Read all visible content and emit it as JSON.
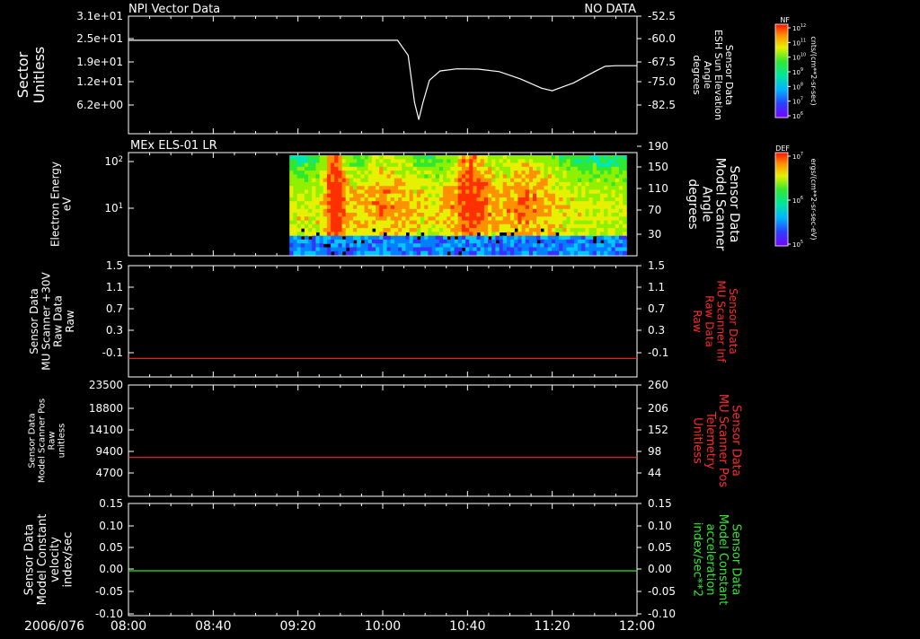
{
  "header": {
    "left_title": "NPI Vector Data",
    "right_status": "NO DATA"
  },
  "time_axis": {
    "date_label": "2006/076",
    "ticks": [
      "08:00",
      "08:40",
      "09:20",
      "10:00",
      "10:40",
      "11:20",
      "12:00"
    ]
  },
  "colors": {
    "background": "#000000",
    "axis": "#ffffff",
    "red_trace": "#ff2a2a",
    "green_trace": "#2ee82e",
    "red_label": "#ff2a2a",
    "green_label": "#2ee82e"
  },
  "colorbars": [
    {
      "title": "NF",
      "ticks": [
        "10^12",
        "10^11",
        "10^10",
        "10^9",
        "10^8",
        "10^7",
        "10^6"
      ],
      "units": "cnts/(cm**2-sr-sec)"
    },
    {
      "title": "DEF",
      "ticks": [
        "10^7",
        "10^6",
        "10^5"
      ],
      "units": "ergs/(cm**2-sr-sec-eV)"
    }
  ],
  "chart_data": [
    {
      "type": "line",
      "panel": 1,
      "left_axis": {
        "label_lines": [
          "Sector",
          "Unitless"
        ],
        "ticks": [
          "3.1e+01",
          "2.5e+01",
          "1.9e+01",
          "1.2e+01",
          "6.2e+00"
        ]
      },
      "right_axis": {
        "label_lines": [
          "Sensor Data",
          "ESH Sun Elevation",
          "Angle",
          "degrees"
        ],
        "ticks": [
          "-52.5",
          "-60.0",
          "-67.5",
          "-75.0",
          "-82.5"
        ],
        "range": [
          -90,
          -52.5
        ]
      },
      "series": [
        {
          "color": "#ffffff",
          "x": [
            "08:00",
            "09:00",
            "10:00",
            "10:07",
            "10:12",
            "10:15",
            "10:17",
            "10:19",
            "10:22",
            "10:27",
            "10:35",
            "10:45",
            "10:55",
            "11:05",
            "11:15",
            "11:20",
            "11:30",
            "11:40",
            "11:45",
            "11:50",
            "12:00"
          ],
          "y": [
            -60.2,
            -60.2,
            -60.2,
            -60.2,
            -65,
            -80,
            -85.5,
            -80,
            -73,
            -70,
            -69.3,
            -69.4,
            -70.2,
            -72.5,
            -75.5,
            -76.3,
            -73.8,
            -70.2,
            -68.5,
            -68.3,
            -68.3
          ]
        }
      ]
    },
    {
      "type": "heatmap",
      "panel": 2,
      "title": "MEx ELS-01 LR",
      "left_axis": {
        "label_lines": [
          "Electron Energy",
          "eV"
        ],
        "ticks": [
          "10^2",
          "10^1"
        ],
        "scale": "log"
      },
      "right_axis": {
        "label_lines": [
          "Sensor Data",
          "Model Scanner",
          "Angle",
          "degrees"
        ],
        "ticks": [
          "190",
          "150",
          "110",
          "70",
          "30"
        ]
      },
      "data_extent_time": [
        "09:16",
        "11:55"
      ],
      "notes": "spectrogram with strong bursts near 09:35, 09:45-10:00, 10:35-10:50, 11:00-11:10"
    },
    {
      "type": "line",
      "panel": 3,
      "left_axis": {
        "label_lines": [
          "Sensor Data",
          "MU Scanner +30V",
          "Raw Data",
          "Raw"
        ],
        "ticks": [
          "1.5",
          "1.1",
          "0.7",
          "0.3",
          "-0.1"
        ],
        "range": [
          -0.3,
          1.5
        ]
      },
      "right_axis": {
        "label_lines": [
          "Sensor Data",
          "MU Scanner Inf",
          "Raw Data",
          "Raw"
        ],
        "ticks": [
          "1.5",
          "1.1",
          "0.7",
          "0.3",
          "-0.1"
        ]
      },
      "series": [
        {
          "color": "#ff2a2a",
          "x": [
            "08:00",
            "12:00"
          ],
          "y": [
            0.0,
            0.0
          ]
        }
      ]
    },
    {
      "type": "line",
      "panel": 4,
      "left_axis": {
        "label_lines": [
          "Sensor Data",
          "Model Scanner Pos",
          "Raw",
          "unitless"
        ],
        "ticks": [
          "23500",
          "18800",
          "14100",
          "9400",
          "4700"
        ],
        "range": [
          0,
          23500
        ]
      },
      "right_axis": {
        "label_lines": [
          "Sensor Data",
          "MU Scanner Pos",
          "Telemetry",
          "Unitless"
        ],
        "ticks": [
          "260",
          "206",
          "152",
          "98",
          "44"
        ]
      },
      "series": [
        {
          "color": "#ff2a2a",
          "x": [
            "08:00",
            "12:00"
          ],
          "y": [
            8200,
            8200
          ]
        }
      ]
    },
    {
      "type": "line",
      "panel": 5,
      "left_axis": {
        "label_lines": [
          "Sensor Data",
          "Model Constant",
          "velocity",
          "index/sec"
        ],
        "ticks": [
          "0.15",
          "0.10",
          "0.05",
          "0.00",
          "-0.05",
          "-0.10"
        ],
        "range": [
          -0.1,
          0.15
        ]
      },
      "right_axis": {
        "label_lines": [
          "Sensor Data",
          "Model Constant",
          "acceleration",
          "index/sec**2"
        ],
        "ticks": [
          "0.15",
          "0.10",
          "0.05",
          "0.00",
          "-0.05",
          "-0.10"
        ]
      },
      "series": [
        {
          "color": "#2ee82e",
          "x": [
            "08:00",
            "12:00"
          ],
          "y": [
            0.0,
            0.0
          ]
        }
      ]
    }
  ]
}
